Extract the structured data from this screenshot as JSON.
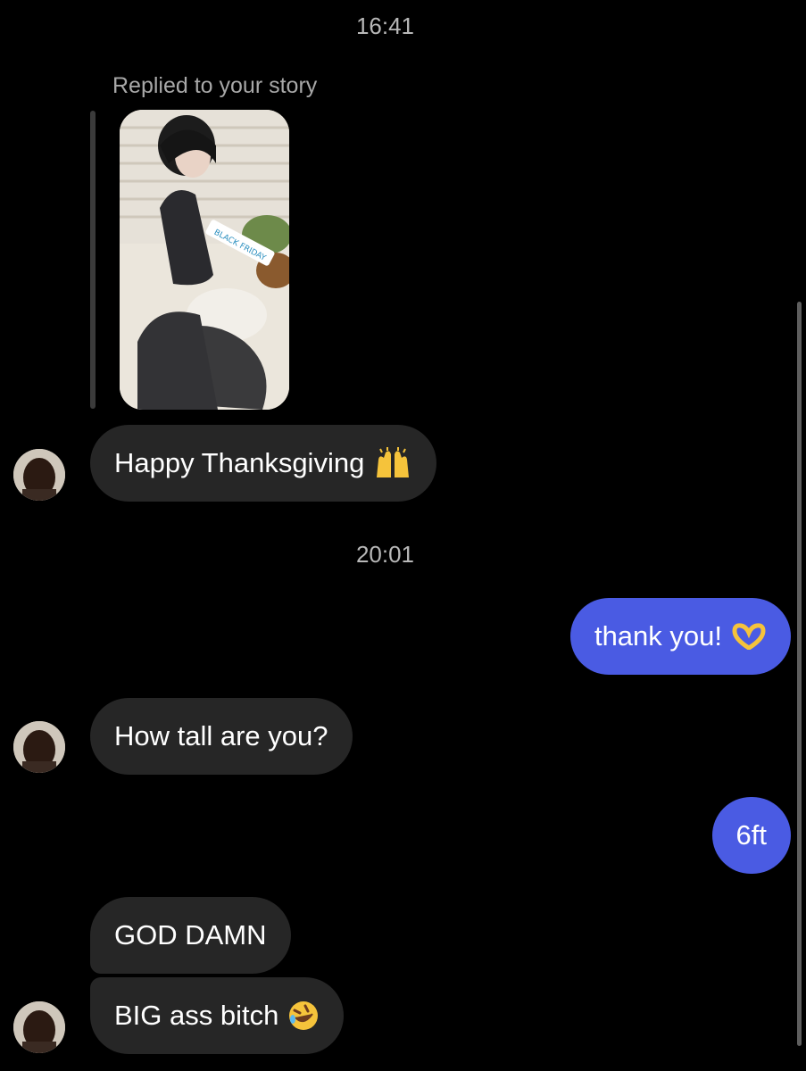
{
  "timestamps": [
    "16:41",
    "20:01"
  ],
  "story_reply": {
    "label": "Replied to your story",
    "sticker_text": "BLACK FRIDAY"
  },
  "messages": [
    {
      "from": "them",
      "text": "Happy Thanksgiving",
      "emoji": "raising-hands-icon"
    },
    {
      "from": "me",
      "text": "thank you!",
      "emoji": "heart-hands-icon"
    },
    {
      "from": "them",
      "text": "How tall are you?"
    },
    {
      "from": "me",
      "text": "6ft"
    },
    {
      "from": "them",
      "text": "GOD DAMN"
    },
    {
      "from": "them",
      "text": "BIG ass bitch",
      "emoji": "rolling-laughing-icon"
    }
  ],
  "colors": {
    "background": "#000000",
    "incoming_bubble": "#262626",
    "outgoing_bubble": "#4a5be3",
    "timestamp": "#b8b8b8"
  }
}
